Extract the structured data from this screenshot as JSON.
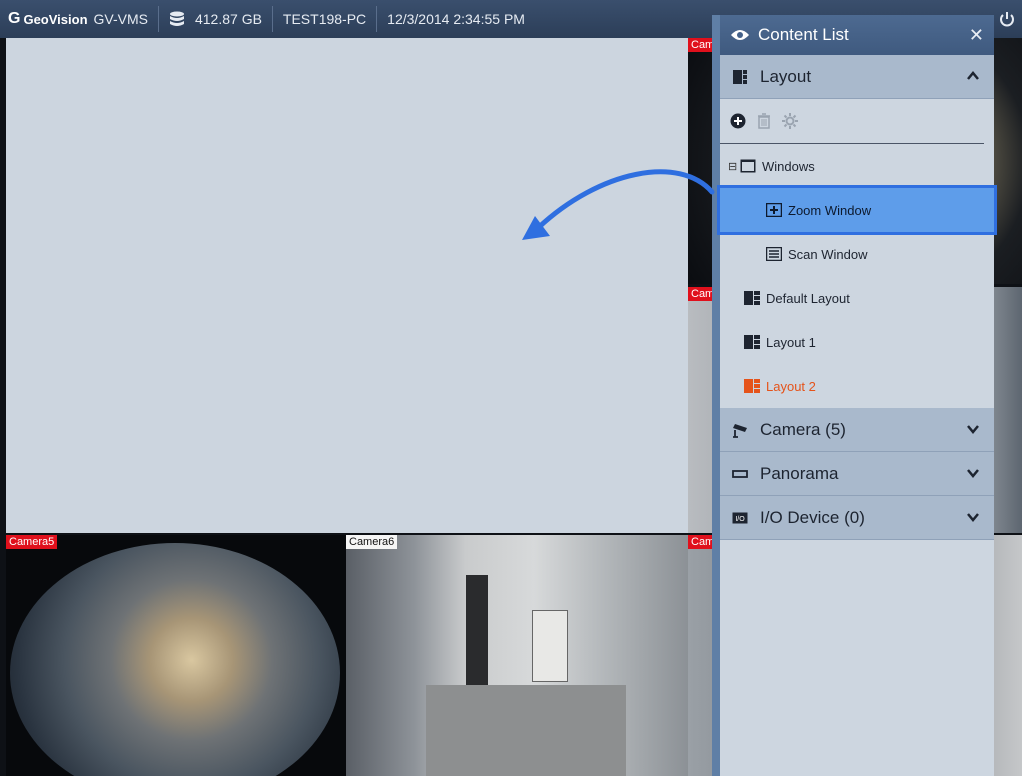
{
  "topbar": {
    "brand": "GeoVision",
    "app": "GV-VMS",
    "storage": "412.87 GB",
    "pc_name": "TEST198-PC",
    "datetime": "12/3/2014 2:34:55 PM",
    "icons": [
      "database-icon",
      "power-icon"
    ]
  },
  "cameras": [
    {
      "label": "Cam",
      "position": "right-top"
    },
    {
      "label": "Cam",
      "position": "right-middle"
    },
    {
      "label": "Cam",
      "position": "right-bottom"
    },
    {
      "label": "Camera5",
      "position": "bottom-left"
    },
    {
      "label": "Camera6",
      "position": "bottom-middle"
    }
  ],
  "panel": {
    "title": "Content List",
    "layout_section": {
      "title": "Layout",
      "toolbar": [
        "add-icon",
        "delete-icon",
        "settings-icon"
      ],
      "tree": {
        "windows": "Windows",
        "zoom_window": "Zoom Window",
        "scan_window": "Scan Window",
        "default_layout": "Default Layout",
        "layout1": "Layout 1",
        "layout2": "Layout 2"
      }
    },
    "camera_section": "Camera (5)",
    "panorama_section": "Panorama",
    "io_section": "I/O Device (0)"
  },
  "colors": {
    "accent": "#2f6fe0",
    "selected": "#5e9dea",
    "active_layout": "#e5531a",
    "camera_label": "#e0101c"
  }
}
